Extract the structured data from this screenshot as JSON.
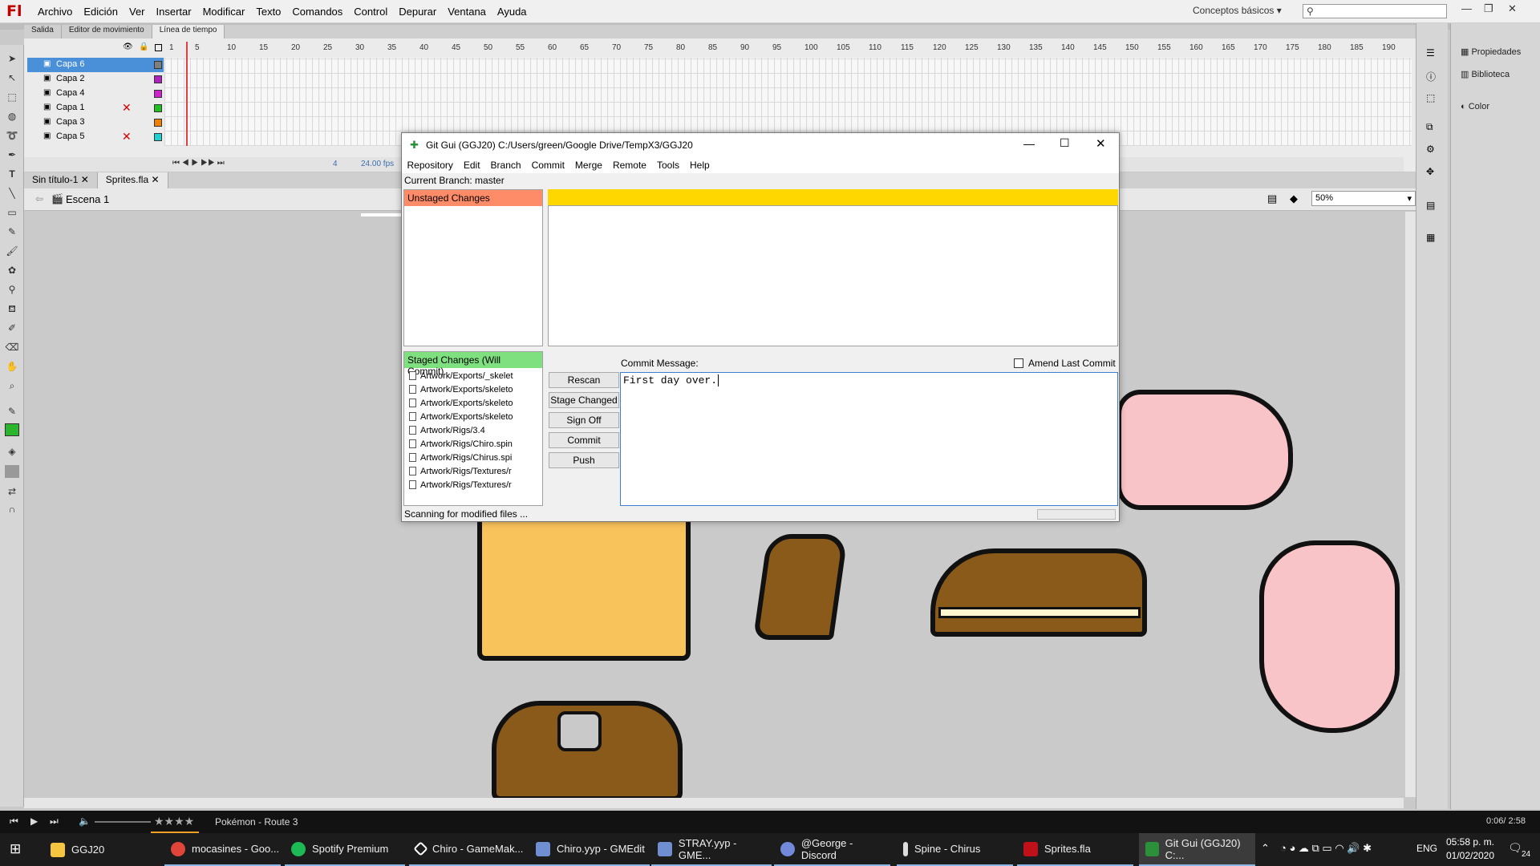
{
  "app": {
    "logo": "Fl",
    "menu": [
      "Archivo",
      "Edición",
      "Ver",
      "Insertar",
      "Modificar",
      "Texto",
      "Comandos",
      "Control",
      "Depurar",
      "Ventana",
      "Ayuda"
    ],
    "workspace": "Conceptos básicos"
  },
  "timeline": {
    "tabs": [
      "Salida",
      "Editor de movimiento",
      "Línea de tiempo"
    ],
    "layers": [
      {
        "name": "Capa 6",
        "color": "#7f7f7f"
      },
      {
        "name": "Capa 2",
        "color": "#b020c0"
      },
      {
        "name": "Capa 4",
        "color": "#d020d0"
      },
      {
        "name": "Capa 1",
        "color": "#20c020"
      },
      {
        "name": "Capa 3",
        "color": "#f08000"
      },
      {
        "name": "Capa 5",
        "color": "#20d0d0"
      }
    ],
    "ruler": [
      "1",
      "5",
      "10",
      "15",
      "20",
      "25",
      "30",
      "35",
      "40",
      "45",
      "50",
      "55",
      "60",
      "65",
      "70",
      "75",
      "80",
      "85",
      "90",
      "95",
      "100",
      "105",
      "110",
      "115",
      "120",
      "125",
      "130",
      "135",
      "140",
      "145",
      "150",
      "155",
      "160",
      "165",
      "170",
      "175",
      "180",
      "185",
      "190"
    ],
    "frame": "4",
    "fps": "24.00 fps"
  },
  "docs": {
    "tabs": [
      "Sin título-1",
      "Sprites.fla"
    ],
    "scene": "Escena 1",
    "zoom": "50%"
  },
  "right_panel": {
    "items": [
      "Propiedades",
      "Biblioteca",
      "Color"
    ]
  },
  "git": {
    "title": "Git Gui (GGJ20) C:/Users/green/Google Drive/TempX3/GGJ20",
    "menu": [
      "Repository",
      "Edit",
      "Branch",
      "Commit",
      "Merge",
      "Remote",
      "Tools",
      "Help"
    ],
    "branch": "Current Branch: master",
    "unstaged_header": "Unstaged Changes",
    "staged_header": "Staged Changes (Will Commit)",
    "staged_files": [
      "Artwork/Exports/_skelet",
      "Artwork/Exports/skeleto",
      "Artwork/Exports/skeleto",
      "Artwork/Exports/skeleto",
      "Artwork/Rigs/3.4",
      "Artwork/Rigs/Chiro.spin",
      "Artwork/Rigs/Chirus.spi",
      "Artwork/Rigs/Textures/r",
      "Artwork/Rigs/Textures/r"
    ],
    "buttons": [
      "Rescan",
      "Stage Changed",
      "Sign Off",
      "Commit",
      "Push"
    ],
    "commit_label": "Commit Message:",
    "amend_label": "Amend Last Commit",
    "commit_message": "First day over.",
    "status": "Scanning for modified files ..."
  },
  "media": {
    "track": "Pokémon - Route 3",
    "time": "0:06/ 2:58",
    "stars": "★★★★"
  },
  "taskbar": {
    "items": [
      {
        "label": "GGJ20",
        "color": "#f5c542"
      },
      {
        "label": "mocasines - Goo...",
        "color": "#e0453a"
      },
      {
        "label": "Spotify Premium",
        "color": "#1db954"
      },
      {
        "label": "Chiro - GameMak...",
        "color": "#ffffff"
      },
      {
        "label": "Chiro.yyp - GMEdit",
        "color": "#6f8fd0"
      },
      {
        "label": "STRAY.yyp - GME...",
        "color": "#6f8fd0"
      },
      {
        "label": "@George - Discord",
        "color": "#7289da"
      },
      {
        "label": "Spine - Chirus",
        "color": "#dddddd"
      },
      {
        "label": "Sprites.fla",
        "color": "#c0101a"
      },
      {
        "label": "Git Gui (GGJ20) C:...",
        "color": "#2c8f3a"
      }
    ],
    "lang": "ENG",
    "time": "05:58 p. m.",
    "date": "01/02/2020",
    "notifications": "24"
  }
}
